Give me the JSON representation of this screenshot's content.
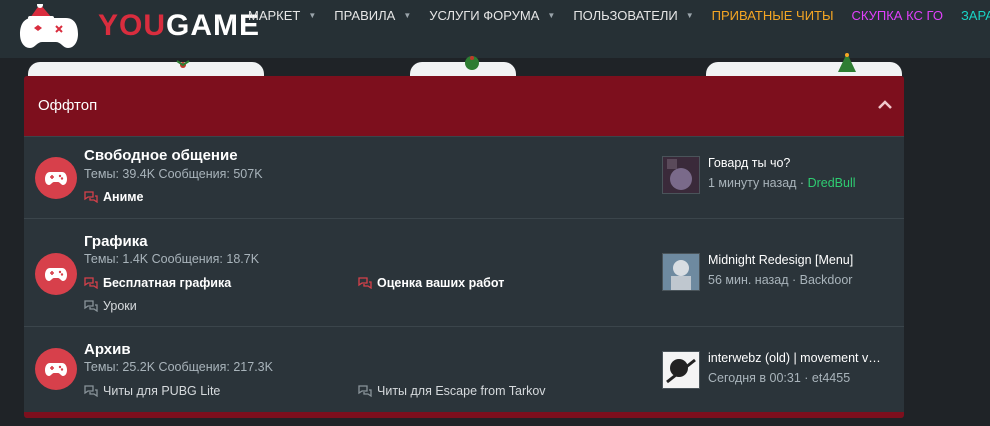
{
  "logo": {
    "brand_you": "YOU",
    "brand_game": "GAME"
  },
  "nav": [
    {
      "label": "МАРКЕТ",
      "caret": true,
      "color": "#e6e6e6"
    },
    {
      "label": "ПРАВИЛА",
      "caret": true,
      "color": "#e6e6e6"
    },
    {
      "label": "УСЛУГИ ФОРУМА",
      "caret": true,
      "color": "#e6e6e6"
    },
    {
      "label": "ПОЛЬЗОВАТЕЛИ",
      "caret": true,
      "color": "#e6e6e6"
    },
    {
      "label": "ПРИВАТНЫЕ ЧИТЫ",
      "caret": false,
      "color": "#f5a623"
    },
    {
      "label": "СКУПКА КС ГО",
      "caret": false,
      "color": "#e040fb"
    },
    {
      "label": "ЗАРАБ",
      "caret": false,
      "color": "#19d3c5"
    }
  ],
  "category": {
    "title": "Оффтоп",
    "collapse_icon": "chevron-up-icon"
  },
  "nodes": [
    {
      "title": "Свободное общение",
      "stats": "Темы: 39.4K Сообщения: 507K",
      "subforums": [
        {
          "label": "Аниме",
          "unread": true
        }
      ],
      "last_post": {
        "title": "Говард ты чо?",
        "time": "1 минуту назад",
        "sep": "·",
        "user": "DredBull"
      }
    },
    {
      "title": "Графика",
      "stats": "Темы: 1.4K Сообщения: 18.7K",
      "subforums": [
        {
          "label": "Бесплатная графика",
          "unread": true
        },
        {
          "label": "Оценка ваших работ",
          "unread": true
        },
        {
          "label": "Уроки",
          "unread": false
        }
      ],
      "last_post": {
        "title": "Midnight Redesign [Menu]",
        "time": "56 мин. назад",
        "sep": "·",
        "user": "Backdoor"
      }
    },
    {
      "title": "Архив",
      "stats": "Темы: 25.2K Сообщения: 217.3K",
      "subforums": [
        {
          "label": "Читы для PUBG Lite",
          "unread": false
        },
        {
          "label": "Читы для Escape from Tarkov",
          "unread": false
        }
      ],
      "last_post": {
        "title": "interwebz (old) | movement v…",
        "time": "Сегодня в 00:31",
        "sep": "·",
        "user": "et4455"
      }
    }
  ],
  "colors": {
    "accent": "#d7404b",
    "header_bg": "#7d0f1d",
    "online_user": "#2ecc71"
  }
}
